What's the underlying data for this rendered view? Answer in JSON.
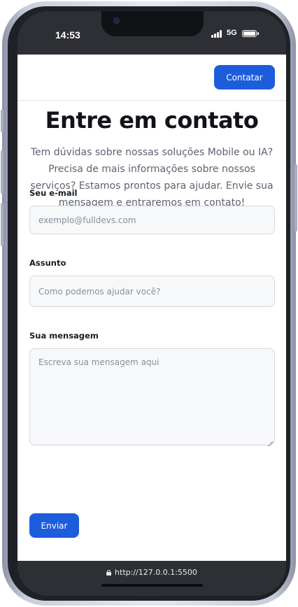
{
  "status_bar": {
    "time": "14:53",
    "network": "5G"
  },
  "header": {
    "contact_button": "Contatar"
  },
  "main": {
    "title": "Entre em contato",
    "description": "Tem dúvidas sobre nossas soluções Mobile ou IA? Precisa de mais informações sobre nossos serviços? Estamos prontos para ajudar. Envie sua mensagem e entraremos em contato!"
  },
  "form": {
    "email": {
      "label": "Seu e-mail",
      "placeholder": "exemplo@fulldevs.com",
      "value": ""
    },
    "subject": {
      "label": "Assunto",
      "placeholder": "Como podemos ajudar você?",
      "value": ""
    },
    "message": {
      "label": "Sua mensagem",
      "placeholder": "Escreva sua mensagem aqui",
      "value": ""
    },
    "submit_label": "Enviar"
  },
  "browser": {
    "url": "http://127.0.0.1:5500"
  },
  "colors": {
    "accent": "#1d5ddb",
    "heading": "#111318",
    "body_text": "#5c6270",
    "frame_dark": "#2d2f35"
  },
  "icons": {
    "signal": "cellular-signal-icon",
    "battery": "battery-icon",
    "lock": "lock-icon",
    "resize": "resize-grip-icon"
  }
}
